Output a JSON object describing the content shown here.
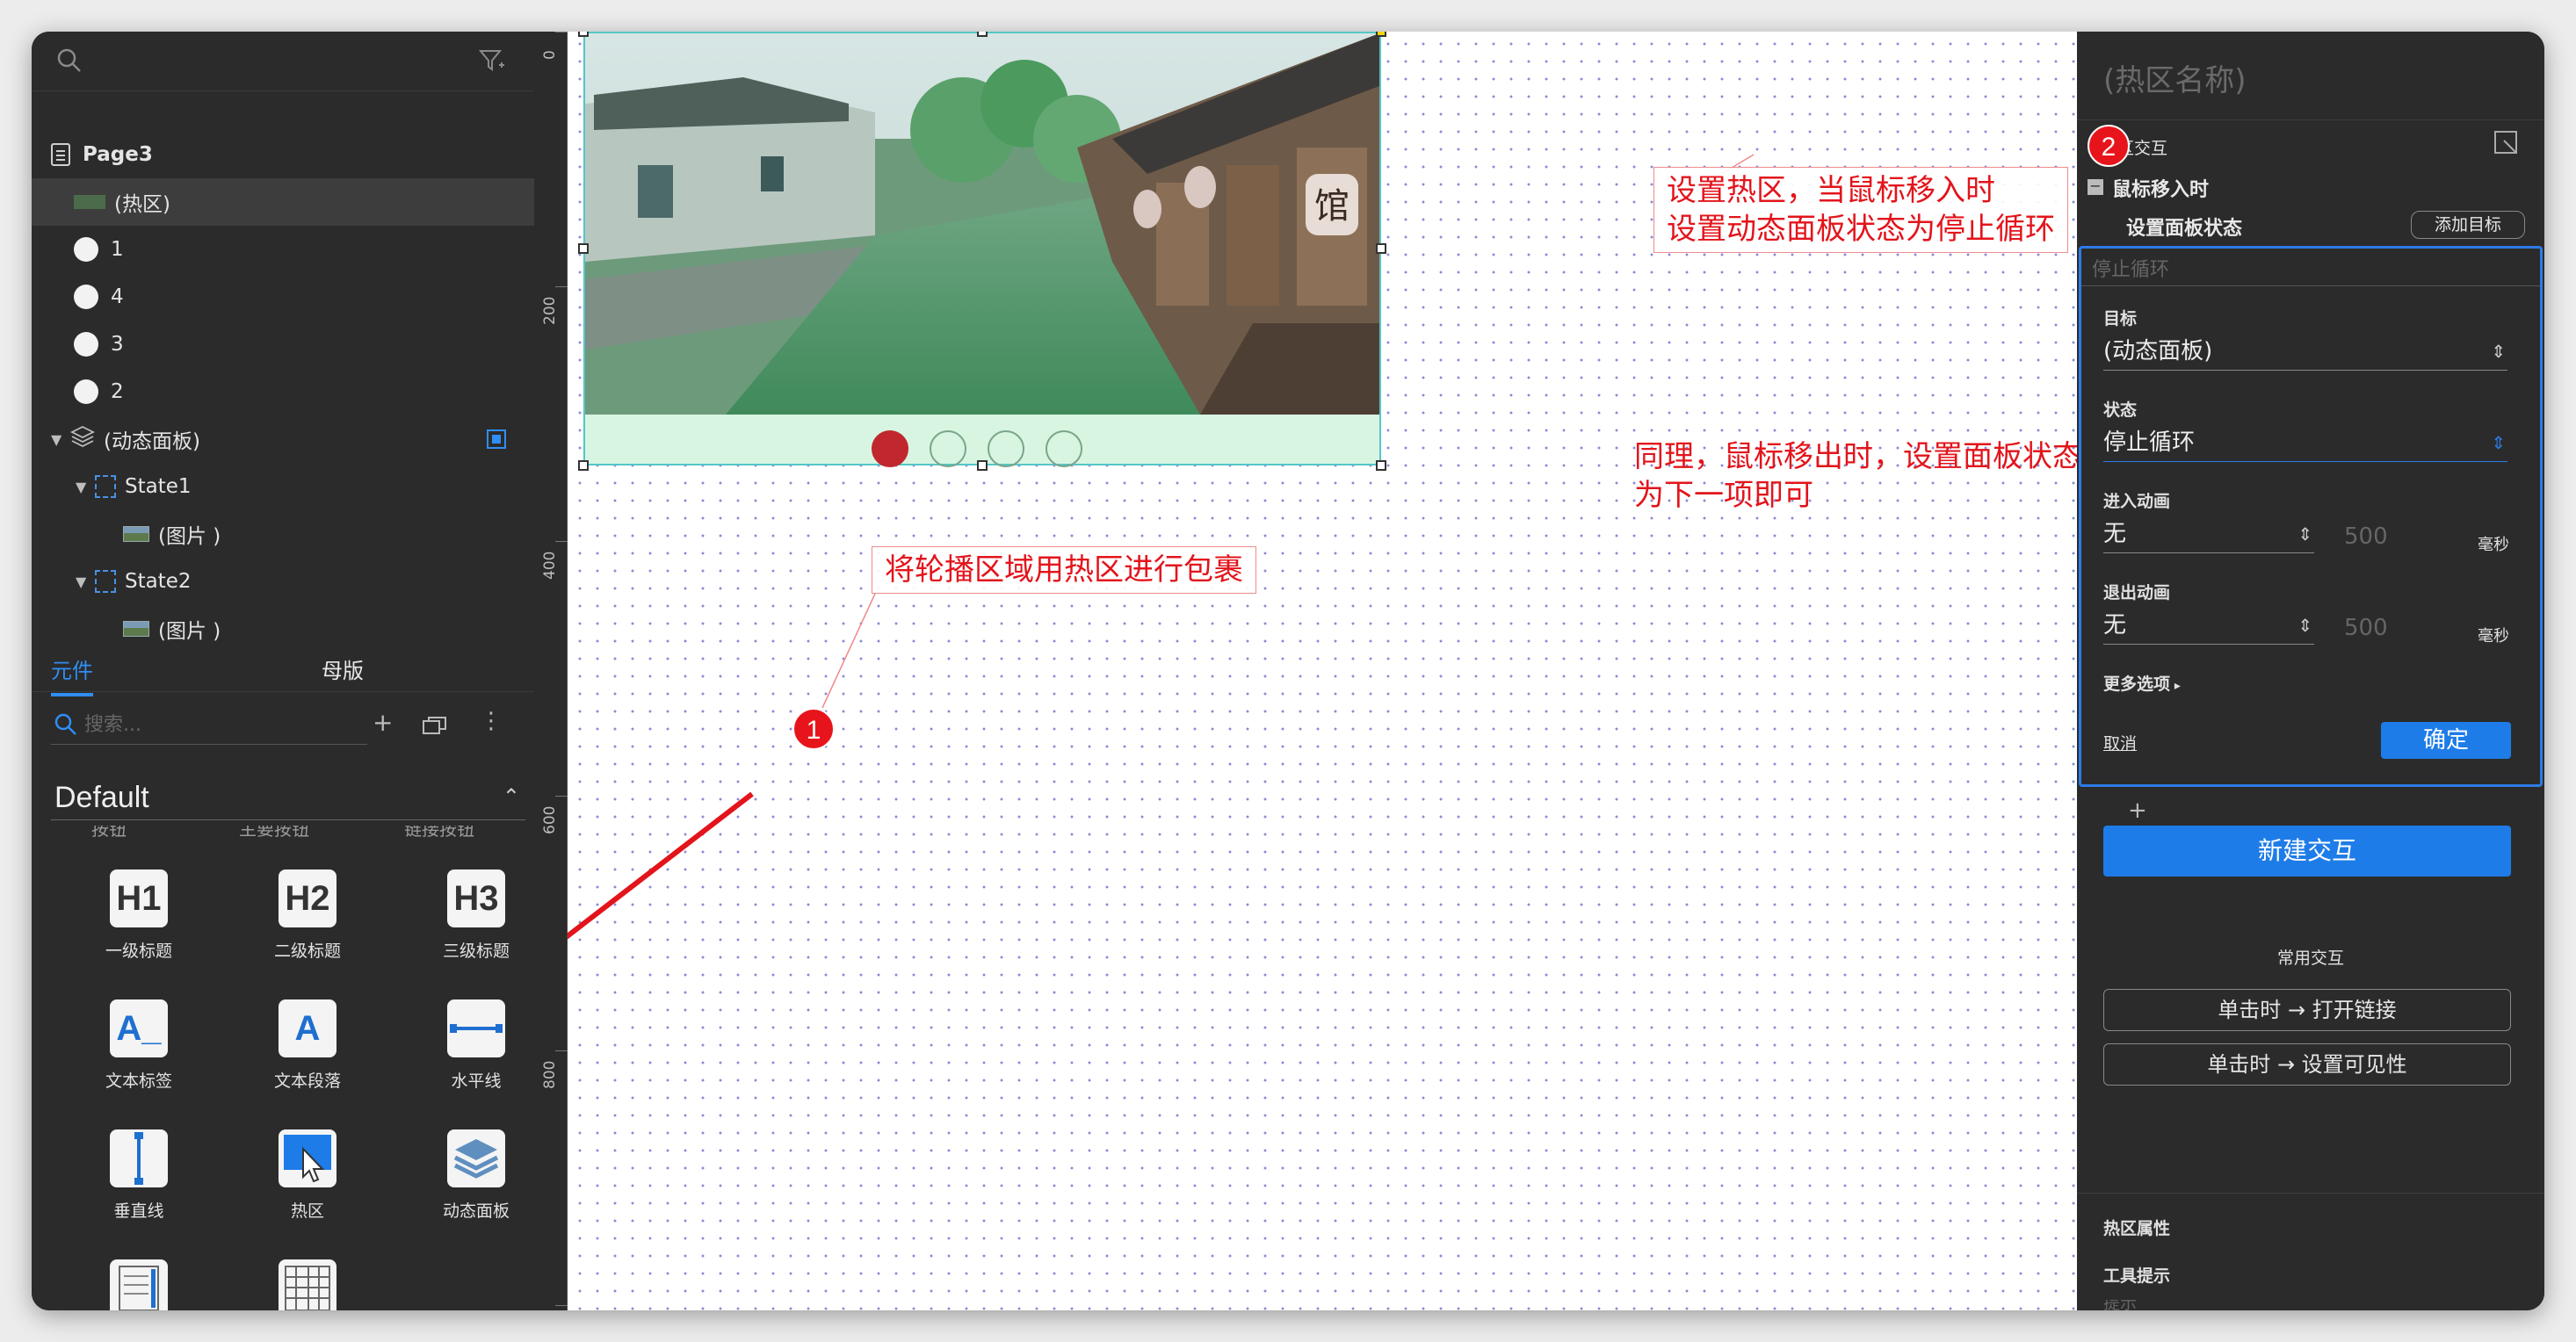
{
  "left_panel": {
    "outline": {
      "page": "Page3",
      "items": [
        "(热区)",
        "1",
        "4",
        "3",
        "2",
        "(动态面板)",
        "State1",
        "(图片 )",
        "State2",
        "(图片 )"
      ]
    },
    "library": {
      "tabs": [
        "元件",
        "母版"
      ],
      "search_placeholder": "搜索...",
      "library_name": "Default",
      "clipped_labels": [
        "按钮",
        "主要按钮",
        "链接按钮"
      ],
      "widgets": [
        {
          "icon_text": "H1",
          "label": "一级标题"
        },
        {
          "icon_text": "H2",
          "label": "二级标题"
        },
        {
          "icon_text": "H3",
          "label": "三级标题"
        },
        {
          "icon_text": "A_",
          "label": "文本标签"
        },
        {
          "icon_text": "A",
          "label": "文本段落"
        },
        {
          "icon_text": "",
          "label": "水平线"
        },
        {
          "icon_text": "",
          "label": "垂直线"
        },
        {
          "icon_text": "",
          "label": "热区"
        },
        {
          "icon_text": "",
          "label": "动态面板"
        }
      ]
    }
  },
  "canvas": {
    "ruler_ticks": [
      "0",
      "200",
      "400",
      "600",
      "800"
    ],
    "shop_sign": "馆",
    "notes": {
      "note1": "将轮播区域用热区进行包裹",
      "note2_line1": "设置热区，当鼠标移入时",
      "note2_line2": "设置动态面板状态为停止循环",
      "note3_line1": "同理，鼠标移出时，设置面板状态",
      "note3_line2": "为下一项即可"
    },
    "badges": [
      "1",
      "2"
    ],
    "carousel_dots": {
      "count": 4,
      "active_index": 0
    }
  },
  "right_panel": {
    "title": "(热区名称)",
    "section_label": "区交互",
    "event": "鼠标移入时",
    "action": "设置面板状态",
    "add_target": "添加目标",
    "action_placeholder": "停止循环",
    "target_label": "目标",
    "target_value": "(动态面板)",
    "state_label": "状态",
    "state_value": "停止循环",
    "enter_anim_label": "进入动画",
    "enter_anim_value": "无",
    "enter_anim_ms": "500",
    "exit_anim_label": "退出动画",
    "exit_anim_value": "无",
    "exit_anim_ms": "500",
    "ms_unit": "毫秒",
    "more_options": "更多选项",
    "cancel": "取消",
    "confirm": "确定",
    "plus": "+",
    "new_interaction": "新建交互",
    "common_interactions": "常用交互",
    "quick_actions": [
      "单击时 → 打开链接",
      "单击时 → 设置可见性"
    ],
    "hotspot_props": "热区属性",
    "tooltip": "工具提示",
    "tooltip_clipped": "提示"
  },
  "colors": {
    "accent_blue": "#2d7be6",
    "annotation_red": "#e3141b",
    "panel_bg": "#2b2b2b",
    "hotspot_cyan": "#56c6c6"
  }
}
